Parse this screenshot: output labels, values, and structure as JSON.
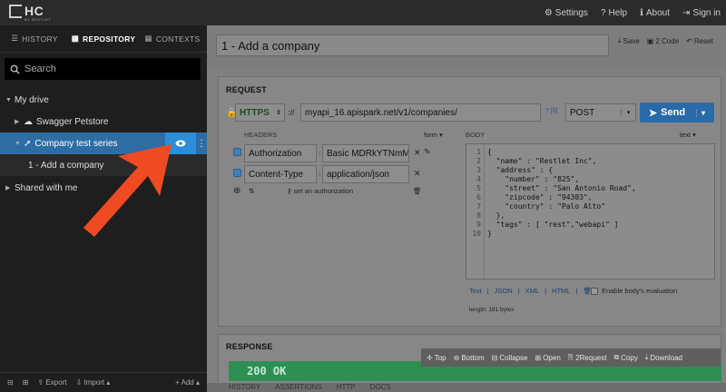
{
  "app": {
    "logo_text": "HC",
    "logo_sub": "BY RESTLET"
  },
  "topnav": {
    "settings": "Settings",
    "help": "Help",
    "about": "About",
    "signin": "Sign in"
  },
  "sidebar": {
    "tabs": [
      "HISTORY",
      "REPOSITORY",
      "CONTEXTS"
    ],
    "search_placeholder": "Search",
    "tree": {
      "root": "My drive",
      "items": [
        "Swagger Petstore",
        "Company test series",
        "1 - Add a company",
        "Shared with me"
      ]
    },
    "footer": {
      "export": "Export",
      "import": "Import",
      "add": "Add"
    }
  },
  "request_title": "1 - Add a company",
  "title_actions": {
    "save": "Save",
    "code": "2 Code",
    "reset": "Reset"
  },
  "request": {
    "label": "REQUEST",
    "scheme": "HTTPS",
    "scheme_sep": "://",
    "url": "myapi_16.apispark.net/v1/companies/",
    "url_hint": "? [0]",
    "method": "POST",
    "send": "Send",
    "headers_label": "HEADERS",
    "form_label": "form",
    "headers": [
      {
        "name": "Authorization",
        "value": "Basic MDRkYTNmMDA"
      },
      {
        "name": "Content-Type",
        "value": "application/json"
      }
    ],
    "set_auth": "set an authorization",
    "body_label": "BODY",
    "body_format": "text",
    "body_lines": [
      "{",
      "  \"name\" : \"Restlet Inc\",",
      "  \"address\" : {",
      "    \"number\" : \"825\",",
      "    \"street\" : \"San Antonio Road\",",
      "    \"zipcode\" : \"94303\",",
      "    \"country\" : \"Palo Alto\"",
      "  },",
      "  \"tags\" : [ \"rest\",\"webapi\" ]",
      "}"
    ],
    "body_formats": [
      "Text",
      "JSON",
      "XML",
      "HTML"
    ],
    "body_eval": "Enable body's evaluation",
    "body_length": "length: 191 bytes"
  },
  "response": {
    "label": "RESPONSE",
    "status": "200 OK",
    "toolbar": [
      "Top",
      "Bottom",
      "Collapse",
      "Open",
      "2Request",
      "Copy",
      "Download"
    ]
  },
  "bottom_tabs": [
    "HISTORY",
    "ASSERTIONS",
    "HTTP",
    "DOCS"
  ],
  "colors": {
    "accent": "#2b8ed8",
    "arrow": "#f04a23",
    "status_ok": "#2e8f55"
  }
}
